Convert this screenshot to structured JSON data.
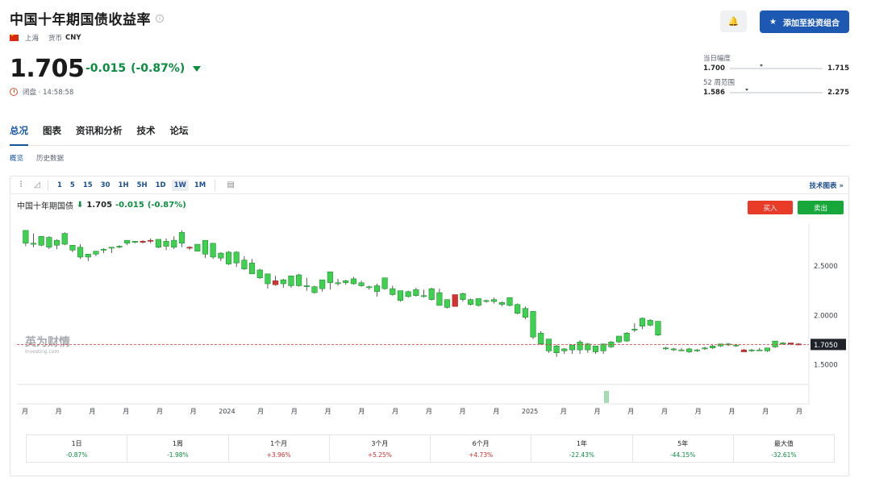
{
  "header": {
    "title": "中国十年期国债收益率",
    "location": "上海",
    "currency_label": "货币",
    "currency": "CNY",
    "price": "1.705",
    "change": "-0.015",
    "change_pct": "(-0.87%)",
    "status": "闭盘 · 14:58:58",
    "watchlist_button": "添加至投资组合",
    "day_range": {
      "label": "当日幅度",
      "low": "1.700",
      "high": "1.715"
    },
    "week52_range": {
      "label": "52 周范围",
      "low": "1.586",
      "high": "2.275"
    }
  },
  "tabs": [
    "总况",
    "图表",
    "资讯和分析",
    "技术",
    "论坛"
  ],
  "subtabs": [
    "概览",
    "历史数据"
  ],
  "chart_toolbar": {
    "timeframes": [
      "1",
      "5",
      "15",
      "30",
      "1H",
      "5H",
      "1D",
      "1W",
      "1M"
    ],
    "active_timeframe": "1W",
    "technical_link": "技术图表 »"
  },
  "chart_legend": {
    "name": "中国十年期国债",
    "price": "1.705",
    "change": "-0.015",
    "change_pct": "(-0.87%)"
  },
  "trade_buttons": {
    "buy": "买入",
    "sell": "卖出"
  },
  "watermark": {
    "brand": "英为财情",
    "sub": "Investing.com"
  },
  "chart_data": {
    "type": "candlestick",
    "y_ticks": [
      "2.5000",
      "2.0000",
      "1.5000"
    ],
    "current_price_label": "1.7050",
    "x_labels": [
      "月",
      "月",
      "月",
      "月",
      "月",
      "月",
      "2024",
      "月",
      "月",
      "月",
      "月",
      "月",
      "月",
      "月",
      "月",
      "2025",
      "月",
      "月",
      "月",
      "月",
      "月",
      "月",
      "月",
      "月"
    ],
    "ylim": [
      1.3,
      2.9
    ],
    "candles": [
      {
        "o": 2.73,
        "h": 2.86,
        "l": 2.7,
        "c": 2.86
      },
      {
        "o": 2.72,
        "h": 2.83,
        "l": 2.69,
        "c": 2.73
      },
      {
        "o": 2.71,
        "h": 2.79,
        "l": 2.7,
        "c": 2.8
      },
      {
        "o": 2.69,
        "h": 2.8,
        "l": 2.67,
        "c": 2.79
      },
      {
        "o": 2.71,
        "h": 2.77,
        "l": 2.67,
        "c": 2.76
      },
      {
        "o": 2.72,
        "h": 2.84,
        "l": 2.71,
        "c": 2.83
      },
      {
        "o": 2.66,
        "h": 2.71,
        "l": 2.64,
        "c": 2.71
      },
      {
        "o": 2.59,
        "h": 2.72,
        "l": 2.57,
        "c": 2.69
      },
      {
        "o": 2.59,
        "h": 2.61,
        "l": 2.55,
        "c": 2.62
      },
      {
        "o": 2.62,
        "h": 2.64,
        "l": 2.6,
        "c": 2.65
      },
      {
        "o": 2.66,
        "h": 2.68,
        "l": 2.63,
        "c": 2.67
      },
      {
        "o": 2.68,
        "h": 2.69,
        "l": 2.63,
        "c": 2.69
      },
      {
        "o": 2.69,
        "h": 2.71,
        "l": 2.68,
        "c": 2.7
      },
      {
        "o": 2.73,
        "h": 2.75,
        "l": 2.71,
        "c": 2.76
      },
      {
        "o": 2.74,
        "h": 2.75,
        "l": 2.73,
        "c": 2.75
      },
      {
        "o": 2.75,
        "h": 2.76,
        "l": 2.73,
        "c": 2.74
      },
      {
        "o": 2.76,
        "h": 2.78,
        "l": 2.73,
        "c": 2.75
      },
      {
        "o": 2.69,
        "h": 2.77,
        "l": 2.68,
        "c": 2.77
      },
      {
        "o": 2.7,
        "h": 2.78,
        "l": 2.66,
        "c": 2.75
      },
      {
        "o": 2.69,
        "h": 2.8,
        "l": 2.67,
        "c": 2.76
      },
      {
        "o": 2.73,
        "h": 2.86,
        "l": 2.69,
        "c": 2.84
      },
      {
        "o": 2.69,
        "h": 2.7,
        "l": 2.66,
        "c": 2.68
      },
      {
        "o": 2.65,
        "h": 2.72,
        "l": 2.65,
        "c": 2.72
      },
      {
        "o": 2.62,
        "h": 2.72,
        "l": 2.58,
        "c": 2.76
      },
      {
        "o": 2.59,
        "h": 2.73,
        "l": 2.57,
        "c": 2.73
      },
      {
        "o": 2.58,
        "h": 2.64,
        "l": 2.55,
        "c": 2.63
      },
      {
        "o": 2.52,
        "h": 2.65,
        "l": 2.51,
        "c": 2.64
      },
      {
        "o": 2.53,
        "h": 2.65,
        "l": 2.49,
        "c": 2.64
      },
      {
        "o": 2.47,
        "h": 2.6,
        "l": 2.46,
        "c": 2.56
      },
      {
        "o": 2.42,
        "h": 2.57,
        "l": 2.42,
        "c": 2.53
      },
      {
        "o": 2.38,
        "h": 2.47,
        "l": 2.37,
        "c": 2.46
      },
      {
        "o": 2.32,
        "h": 2.41,
        "l": 2.27,
        "c": 2.42
      },
      {
        "o": 2.35,
        "h": 2.4,
        "l": 2.3,
        "c": 2.31
      },
      {
        "o": 2.32,
        "h": 2.37,
        "l": 2.28,
        "c": 2.36
      },
      {
        "o": 2.3,
        "h": 2.37,
        "l": 2.28,
        "c": 2.4
      },
      {
        "o": 2.3,
        "h": 2.42,
        "l": 2.29,
        "c": 2.41
      },
      {
        "o": 2.29,
        "h": 2.38,
        "l": 2.25,
        "c": 2.3
      },
      {
        "o": 2.23,
        "h": 2.3,
        "l": 2.22,
        "c": 2.29
      },
      {
        "o": 2.27,
        "h": 2.3,
        "l": 2.24,
        "c": 2.36
      },
      {
        "o": 2.33,
        "h": 2.44,
        "l": 2.26,
        "c": 2.44
      },
      {
        "o": 2.33,
        "h": 2.37,
        "l": 2.3,
        "c": 2.33
      },
      {
        "o": 2.33,
        "h": 2.36,
        "l": 2.31,
        "c": 2.35
      },
      {
        "o": 2.32,
        "h": 2.39,
        "l": 2.31,
        "c": 2.37
      },
      {
        "o": 2.3,
        "h": 2.35,
        "l": 2.29,
        "c": 2.33
      },
      {
        "o": 2.28,
        "h": 2.3,
        "l": 2.26,
        "c": 2.29
      },
      {
        "o": 2.24,
        "h": 2.32,
        "l": 2.19,
        "c": 2.3
      },
      {
        "o": 2.27,
        "h": 2.38,
        "l": 2.26,
        "c": 2.38
      },
      {
        "o": 2.21,
        "h": 2.3,
        "l": 2.2,
        "c": 2.27
      },
      {
        "o": 2.15,
        "h": 2.25,
        "l": 2.14,
        "c": 2.25
      },
      {
        "o": 2.19,
        "h": 2.25,
        "l": 2.18,
        "c": 2.24
      },
      {
        "o": 2.2,
        "h": 2.28,
        "l": 2.19,
        "c": 2.26
      },
      {
        "o": 2.19,
        "h": 2.26,
        "l": 2.18,
        "c": 2.2
      },
      {
        "o": 2.16,
        "h": 2.28,
        "l": 2.15,
        "c": 2.27
      },
      {
        "o": 2.1,
        "h": 2.27,
        "l": 2.1,
        "c": 2.23
      },
      {
        "o": 2.08,
        "h": 2.16,
        "l": 2.07,
        "c": 2.16
      },
      {
        "o": 2.21,
        "h": 2.21,
        "l": 2.09,
        "c": 2.09
      },
      {
        "o": 2.16,
        "h": 2.23,
        "l": 2.14,
        "c": 2.22
      },
      {
        "o": 2.11,
        "h": 2.17,
        "l": 2.1,
        "c": 2.16
      },
      {
        "o": 2.1,
        "h": 2.16,
        "l": 2.09,
        "c": 2.17
      },
      {
        "o": 2.14,
        "h": 2.16,
        "l": 2.13,
        "c": 2.15
      },
      {
        "o": 2.14,
        "h": 2.18,
        "l": 2.12,
        "c": 2.16
      },
      {
        "o": 2.11,
        "h": 2.14,
        "l": 2.09,
        "c": 2.13
      },
      {
        "o": 2.1,
        "h": 2.17,
        "l": 2.09,
        "c": 2.18
      },
      {
        "o": 2.02,
        "h": 2.12,
        "l": 2.01,
        "c": 2.11
      },
      {
        "o": 1.98,
        "h": 2.09,
        "l": 1.96,
        "c": 2.07
      },
      {
        "o": 1.78,
        "h": 2.04,
        "l": 1.76,
        "c": 2.04
      },
      {
        "o": 1.71,
        "h": 1.84,
        "l": 1.7,
        "c": 1.82
      },
      {
        "o": 1.64,
        "h": 1.75,
        "l": 1.62,
        "c": 1.76
      },
      {
        "o": 1.62,
        "h": 1.7,
        "l": 1.58,
        "c": 1.69
      },
      {
        "o": 1.64,
        "h": 1.67,
        "l": 1.61,
        "c": 1.66
      },
      {
        "o": 1.65,
        "h": 1.7,
        "l": 1.61,
        "c": 1.7
      },
      {
        "o": 1.65,
        "h": 1.75,
        "l": 1.61,
        "c": 1.73
      },
      {
        "o": 1.65,
        "h": 1.72,
        "l": 1.62,
        "c": 1.71
      },
      {
        "o": 1.63,
        "h": 1.69,
        "l": 1.61,
        "c": 1.69
      },
      {
        "o": 1.64,
        "h": 1.7,
        "l": 1.61,
        "c": 1.71
      },
      {
        "o": 1.68,
        "h": 1.74,
        "l": 1.67,
        "c": 1.73
      },
      {
        "o": 1.73,
        "h": 1.79,
        "l": 1.72,
        "c": 1.79
      },
      {
        "o": 1.74,
        "h": 1.83,
        "l": 1.73,
        "c": 1.82
      },
      {
        "o": 1.85,
        "h": 1.92,
        "l": 1.83,
        "c": 1.86
      },
      {
        "o": 1.89,
        "h": 1.98,
        "l": 1.86,
        "c": 1.97
      },
      {
        "o": 1.9,
        "h": 1.96,
        "l": 1.89,
        "c": 1.95
      },
      {
        "o": 1.8,
        "h": 1.94,
        "l": 1.79,
        "c": 1.94
      },
      {
        "o": 1.66,
        "h": 1.68,
        "l": 1.65,
        "c": 1.67
      },
      {
        "o": 1.65,
        "h": 1.67,
        "l": 1.64,
        "c": 1.66
      },
      {
        "o": 1.65,
        "h": 1.67,
        "l": 1.64,
        "c": 1.65
      },
      {
        "o": 1.63,
        "h": 1.67,
        "l": 1.62,
        "c": 1.66
      },
      {
        "o": 1.64,
        "h": 1.66,
        "l": 1.63,
        "c": 1.65
      },
      {
        "o": 1.66,
        "h": 1.68,
        "l": 1.65,
        "c": 1.67
      },
      {
        "o": 1.67,
        "h": 1.7,
        "l": 1.66,
        "c": 1.69
      },
      {
        "o": 1.69,
        "h": 1.71,
        "l": 1.68,
        "c": 1.71
      },
      {
        "o": 1.7,
        "h": 1.72,
        "l": 1.69,
        "c": 1.71
      },
      {
        "o": 1.69,
        "h": 1.71,
        "l": 1.68,
        "c": 1.7
      },
      {
        "o": 1.65,
        "h": 1.66,
        "l": 1.63,
        "c": 1.63
      },
      {
        "o": 1.64,
        "h": 1.66,
        "l": 1.63,
        "c": 1.65
      },
      {
        "o": 1.65,
        "h": 1.67,
        "l": 1.64,
        "c": 1.65
      },
      {
        "o": 1.64,
        "h": 1.67,
        "l": 1.63,
        "c": 1.67
      },
      {
        "o": 1.68,
        "h": 1.74,
        "l": 1.67,
        "c": 1.74
      },
      {
        "o": 1.71,
        "h": 1.73,
        "l": 1.7,
        "c": 1.72
      },
      {
        "o": 1.72,
        "h": 1.72,
        "l": 1.7,
        "c": 1.71
      },
      {
        "o": 1.71,
        "h": 1.72,
        "l": 1.7,
        "c": 1.705
      }
    ]
  },
  "performance": [
    {
      "label": "1日",
      "value": "-0.87%",
      "dir": "neg"
    },
    {
      "label": "1周",
      "value": "-1.98%",
      "dir": "neg"
    },
    {
      "label": "1个月",
      "value": "+3.96%",
      "dir": "pos"
    },
    {
      "label": "3个月",
      "value": "+5.25%",
      "dir": "pos"
    },
    {
      "label": "6个月",
      "value": "+4.73%",
      "dir": "pos"
    },
    {
      "label": "1年",
      "value": "-22.43%",
      "dir": "neg"
    },
    {
      "label": "5年",
      "value": "-44.15%",
      "dir": "neg"
    },
    {
      "label": "最大值",
      "value": "-32.61%",
      "dir": "neg"
    }
  ]
}
